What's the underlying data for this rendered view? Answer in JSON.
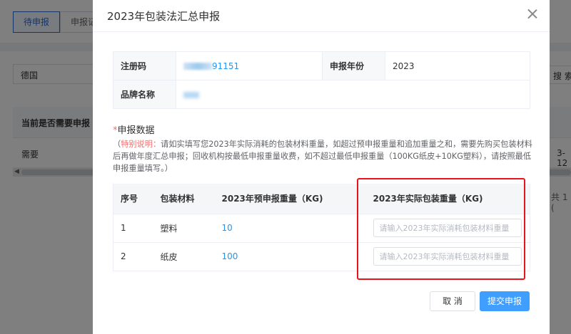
{
  "background": {
    "tabs": [
      {
        "label": "待申报",
        "active": true
      },
      {
        "label": "申报记"
      }
    ],
    "country_select": "德国",
    "search_button": "搜 索",
    "table_header": "当前是否需要申报",
    "table_row": "需要",
    "row_right_text": "3-12",
    "total_text": "共 1 ("
  },
  "dialog": {
    "title": "2023年包装法汇总申报",
    "info": {
      "reg_code_label": "注册码",
      "reg_code_value": "91151",
      "year_label": "申报年份",
      "year_value": "2023",
      "brand_label": "品牌名称",
      "brand_value": ""
    },
    "section": {
      "required_mark": "*",
      "title": "申报数据",
      "note_prefix": "（",
      "note_label": "特别说明：",
      "note_text": "请如实填写您2023年实际消耗的包装材料重量，如超过预申报重量和追加重量之和，需要先购买包装材料后再做年度汇总申报；回收机构按最低申报重量收费，如不超过最低申报重量（100KG纸皮+10KG塑料），请按照最低申报重量填写。）"
    },
    "table": {
      "headers": [
        "序号",
        "包装材料",
        "2023年预申报重量（KG)",
        "2023年实际包装重量（KG)"
      ],
      "rows": [
        {
          "index": "1",
          "material": "塑料",
          "pre_weight": "10",
          "actual_placeholder": "请输入2023年实际消耗包装材料重量",
          "actual_value": ""
        },
        {
          "index": "2",
          "material": "纸皮",
          "pre_weight": "100",
          "actual_placeholder": "请输入2023年实际消耗包装材料重量",
          "actual_value": ""
        }
      ]
    },
    "buttons": {
      "cancel": "取 消",
      "submit": "提交申报"
    }
  },
  "colors": {
    "primary": "#409eff",
    "highlight_border": "#e8141b",
    "note_red": "#f56c6c",
    "value_blue": "#2196f3"
  }
}
